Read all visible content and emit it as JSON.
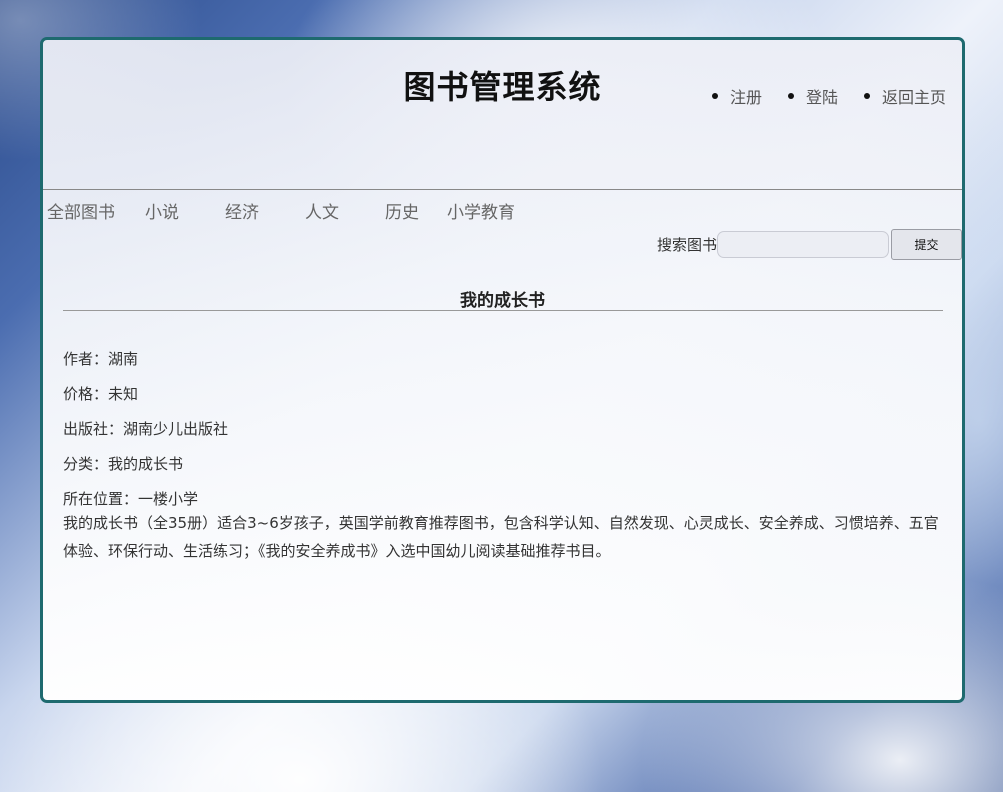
{
  "header": {
    "site_title": "图书管理系统",
    "links": [
      "注册",
      "登陆",
      "返回主页"
    ]
  },
  "categories": [
    "全部图书",
    "小说",
    "经济",
    "人文",
    "历史",
    "小学教育"
  ],
  "search": {
    "label": "搜索图书",
    "value": "",
    "placeholder": "",
    "submit_label": "提交"
  },
  "book": {
    "title": "我的成长书",
    "details": [
      {
        "label": "作者：",
        "value": "湖南"
      },
      {
        "label": "价格：",
        "value": "未知"
      },
      {
        "label": "出版社：",
        "value": "湖南少儿出版社"
      },
      {
        "label": "分类：",
        "value": "我的成长书"
      },
      {
        "label": "所在位置：",
        "value": "一楼小学"
      }
    ],
    "description": "我的成长书（全35册）适合3~6岁孩子，英国学前教育推荐图书，包含科学认知、自然发现、心灵成长、安全养成、习惯培养、五官体验、环保行动、生活练习；《我的安全养成书》入选中国幼儿阅读基础推荐书目。"
  },
  "colors": {
    "panel_border": "#1e6a6f",
    "title_text": "#111111",
    "link_text": "#555555"
  }
}
